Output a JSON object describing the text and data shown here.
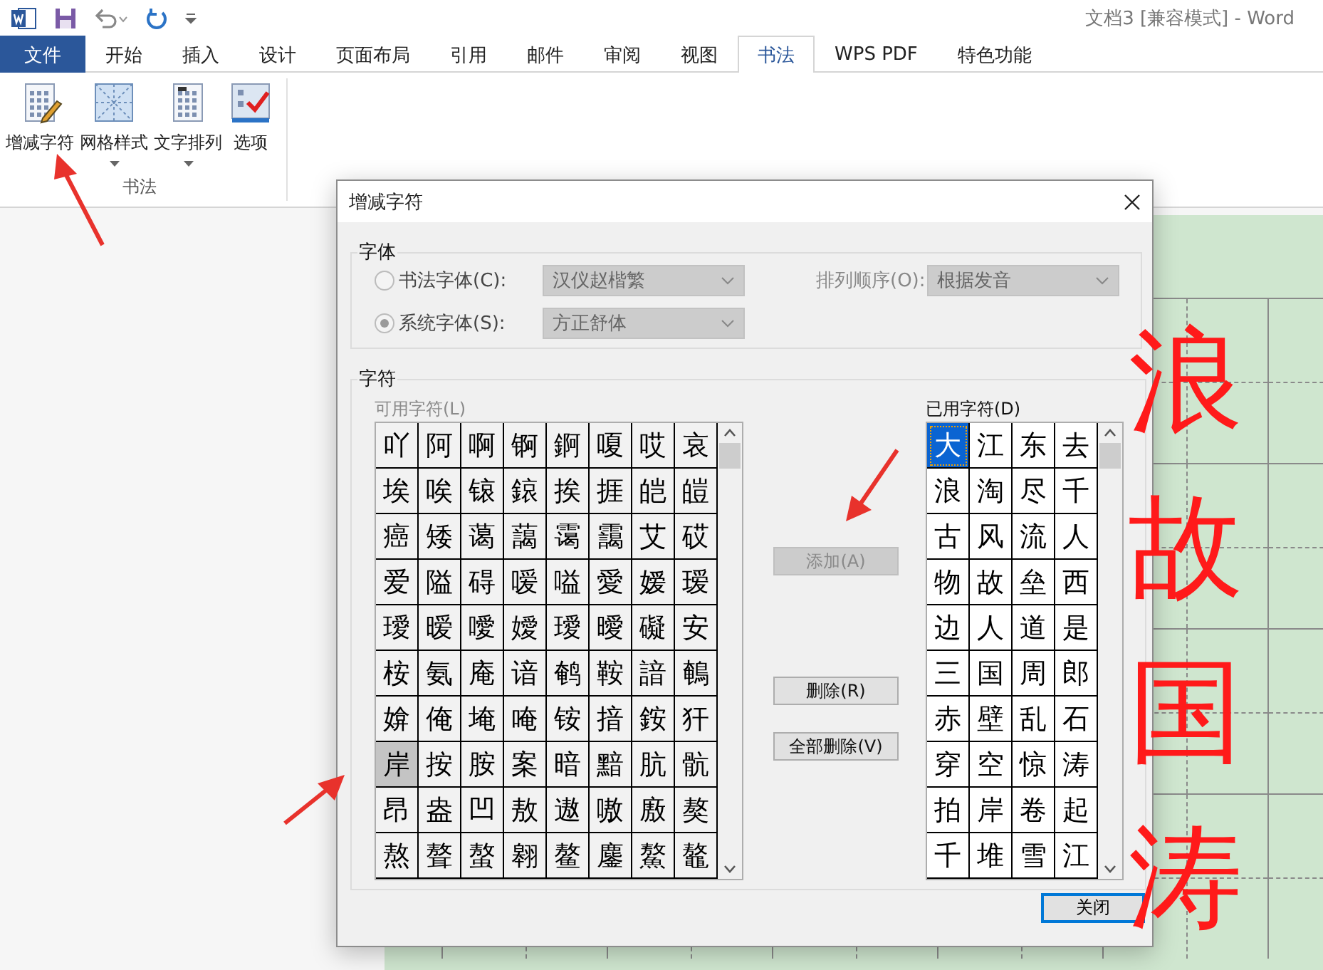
{
  "app": {
    "title": "文档3 [兼容模式] - Word"
  },
  "ribbon_tabs": [
    {
      "label": "文件",
      "kind": "file",
      "selected": false
    },
    {
      "label": "开始",
      "kind": "tab",
      "selected": false
    },
    {
      "label": "插入",
      "kind": "tab",
      "selected": false
    },
    {
      "label": "设计",
      "kind": "tab",
      "selected": false
    },
    {
      "label": "页面布局",
      "kind": "tab",
      "selected": false
    },
    {
      "label": "引用",
      "kind": "tab",
      "selected": false
    },
    {
      "label": "邮件",
      "kind": "tab",
      "selected": false
    },
    {
      "label": "审阅",
      "kind": "tab",
      "selected": false
    },
    {
      "label": "视图",
      "kind": "tab",
      "selected": false
    },
    {
      "label": "书法",
      "kind": "tab",
      "selected": true
    },
    {
      "label": "WPS PDF",
      "kind": "tab",
      "selected": false
    },
    {
      "label": "特色功能",
      "kind": "tab",
      "selected": false
    }
  ],
  "ribbon_buttons": [
    {
      "label": "增减字符",
      "dropdown": false
    },
    {
      "label": "网格样式",
      "dropdown": true
    },
    {
      "label": "文字排列",
      "dropdown": true
    },
    {
      "label": "选项",
      "dropdown": false
    }
  ],
  "ribbon_group": "书法",
  "document": {
    "column_text": [
      "浪",
      "故",
      "国",
      "涛"
    ]
  },
  "dialog": {
    "title": "增减字符",
    "font_group": {
      "label": "字体",
      "options": [
        {
          "label": "书法字体(C):",
          "selected": false,
          "value": "汉仪赵楷繁"
        },
        {
          "label": "系统字体(S):",
          "selected": true,
          "value": "方正舒体"
        }
      ],
      "sort_label": "排列顺序(O):",
      "sort_value": "根据发音"
    },
    "char_group": {
      "label": "字符",
      "available_label": "可用字符(L)",
      "available_disabled": true,
      "available": [
        [
          {
            "c": "吖",
            "selected": false
          },
          {
            "c": "阿",
            "selected": false
          },
          {
            "c": "啊",
            "selected": false
          },
          {
            "c": "锕",
            "selected": false
          },
          {
            "c": "錒",
            "selected": false
          },
          {
            "c": "嗄",
            "selected": false
          },
          {
            "c": "哎",
            "selected": false
          },
          {
            "c": "哀",
            "selected": false
          }
        ],
        [
          {
            "c": "埃",
            "selected": false
          },
          {
            "c": "唉",
            "selected": false
          },
          {
            "c": "锿",
            "selected": false
          },
          {
            "c": "鎄",
            "selected": false
          },
          {
            "c": "挨",
            "selected": false
          },
          {
            "c": "捱",
            "selected": false
          },
          {
            "c": "皑",
            "selected": false
          },
          {
            "c": "皚",
            "selected": false
          }
        ],
        [
          {
            "c": "癌",
            "selected": false
          },
          {
            "c": "矮",
            "selected": false
          },
          {
            "c": "蔼",
            "selected": false
          },
          {
            "c": "藹",
            "selected": false
          },
          {
            "c": "霭",
            "selected": false
          },
          {
            "c": "靄",
            "selected": false
          },
          {
            "c": "艾",
            "selected": false
          },
          {
            "c": "砹",
            "selected": false
          }
        ],
        [
          {
            "c": "爱",
            "selected": false
          },
          {
            "c": "隘",
            "selected": false
          },
          {
            "c": "碍",
            "selected": false
          },
          {
            "c": "嗳",
            "selected": false
          },
          {
            "c": "嗌",
            "selected": false
          },
          {
            "c": "愛",
            "selected": false
          },
          {
            "c": "嫒",
            "selected": false
          },
          {
            "c": "瑷",
            "selected": false
          }
        ],
        [
          {
            "c": "璦",
            "selected": false
          },
          {
            "c": "暧",
            "selected": false
          },
          {
            "c": "噯",
            "selected": false
          },
          {
            "c": "嬡",
            "selected": false
          },
          {
            "c": "璦",
            "selected": false
          },
          {
            "c": "曖",
            "selected": false
          },
          {
            "c": "礙",
            "selected": false
          },
          {
            "c": "安",
            "selected": false
          }
        ],
        [
          {
            "c": "桉",
            "selected": false
          },
          {
            "c": "氨",
            "selected": false
          },
          {
            "c": "庵",
            "selected": false
          },
          {
            "c": "谙",
            "selected": false
          },
          {
            "c": "鹌",
            "selected": false
          },
          {
            "c": "鞍",
            "selected": false
          },
          {
            "c": "諳",
            "selected": false
          },
          {
            "c": "鵪",
            "selected": false
          }
        ],
        [
          {
            "c": "媕",
            "selected": false
          },
          {
            "c": "俺",
            "selected": false
          },
          {
            "c": "埯",
            "selected": false
          },
          {
            "c": "唵",
            "selected": false
          },
          {
            "c": "铵",
            "selected": false
          },
          {
            "c": "揞",
            "selected": false
          },
          {
            "c": "銨",
            "selected": false
          },
          {
            "c": "犴",
            "selected": false
          }
        ],
        [
          {
            "c": "岸",
            "selected": true
          },
          {
            "c": "按",
            "selected": false
          },
          {
            "c": "胺",
            "selected": false
          },
          {
            "c": "案",
            "selected": false
          },
          {
            "c": "暗",
            "selected": false
          },
          {
            "c": "黯",
            "selected": false
          },
          {
            "c": "肮",
            "selected": false
          },
          {
            "c": "骯",
            "selected": false
          }
        ],
        [
          {
            "c": "昂",
            "selected": false
          },
          {
            "c": "盎",
            "selected": false
          },
          {
            "c": "凹",
            "selected": false
          },
          {
            "c": "敖",
            "selected": false
          },
          {
            "c": "遨",
            "selected": false
          },
          {
            "c": "嗷",
            "selected": false
          },
          {
            "c": "廒",
            "selected": false
          },
          {
            "c": "獒",
            "selected": false
          }
        ],
        [
          {
            "c": "熬",
            "selected": false
          },
          {
            "c": "聱",
            "selected": false
          },
          {
            "c": "螯",
            "selected": false
          },
          {
            "c": "翱",
            "selected": false
          },
          {
            "c": "鳌",
            "selected": false
          },
          {
            "c": "鏖",
            "selected": false
          },
          {
            "c": "鰲",
            "selected": false
          },
          {
            "c": "鼇",
            "selected": false
          }
        ]
      ],
      "used_label": "已用字符(D)",
      "used": [
        [
          {
            "c": "大",
            "selected": true
          },
          {
            "c": "江",
            "selected": false
          },
          {
            "c": "东",
            "selected": false
          },
          {
            "c": "去",
            "selected": false
          }
        ],
        [
          {
            "c": "浪",
            "selected": false
          },
          {
            "c": "淘",
            "selected": false
          },
          {
            "c": "尽",
            "selected": false
          },
          {
            "c": "千",
            "selected": false
          }
        ],
        [
          {
            "c": "古",
            "selected": false
          },
          {
            "c": "风",
            "selected": false
          },
          {
            "c": "流",
            "selected": false
          },
          {
            "c": "人",
            "selected": false
          }
        ],
        [
          {
            "c": "物",
            "selected": false
          },
          {
            "c": "故",
            "selected": false
          },
          {
            "c": "垒",
            "selected": false
          },
          {
            "c": "西",
            "selected": false
          }
        ],
        [
          {
            "c": "边",
            "selected": false
          },
          {
            "c": "人",
            "selected": false
          },
          {
            "c": "道",
            "selected": false
          },
          {
            "c": "是",
            "selected": false
          }
        ],
        [
          {
            "c": "三",
            "selected": false
          },
          {
            "c": "国",
            "selected": false
          },
          {
            "c": "周",
            "selected": false
          },
          {
            "c": "郎",
            "selected": false
          }
        ],
        [
          {
            "c": "赤",
            "selected": false
          },
          {
            "c": "壁",
            "selected": false
          },
          {
            "c": "乱",
            "selected": false
          },
          {
            "c": "石",
            "selected": false
          }
        ],
        [
          {
            "c": "穿",
            "selected": false
          },
          {
            "c": "空",
            "selected": false
          },
          {
            "c": "惊",
            "selected": false
          },
          {
            "c": "涛",
            "selected": false
          }
        ],
        [
          {
            "c": "拍",
            "selected": false
          },
          {
            "c": "岸",
            "selected": false
          },
          {
            "c": "卷",
            "selected": false
          },
          {
            "c": "起",
            "selected": false
          }
        ],
        [
          {
            "c": "千",
            "selected": false
          },
          {
            "c": "堆",
            "selected": false
          },
          {
            "c": "雪",
            "selected": false
          },
          {
            "c": "江",
            "selected": false
          }
        ]
      ]
    },
    "buttons": [
      {
        "label": "添加(A)",
        "disabled": true
      },
      {
        "label": "删除(R)",
        "disabled": false
      },
      {
        "label": "全部删除(V)",
        "disabled": false
      }
    ],
    "close_button": "关闭"
  }
}
